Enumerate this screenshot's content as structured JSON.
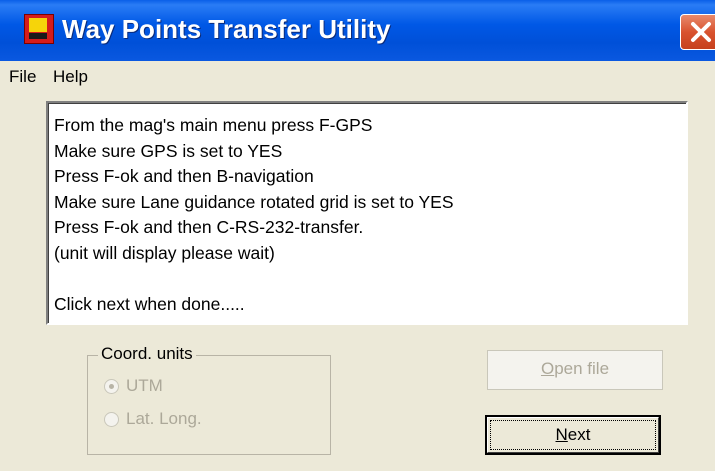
{
  "window": {
    "title": "Way Points Transfer Utility",
    "accent": "#0055e5",
    "close_color": "#d9532f",
    "icons": {
      "app": "app-icon",
      "close": "close-icon"
    }
  },
  "menu": {
    "items": [
      {
        "label": "File"
      },
      {
        "label": "Help"
      }
    ]
  },
  "instructions": {
    "lines": [
      "From the mag's main menu press F-GPS",
      "Make sure GPS is set to YES",
      "Press F-ok and then B-navigation",
      "Make sure Lane guidance rotated grid is set to YES",
      "Press F-ok and then C-RS-232-transfer.",
      "(unit will display please wait)",
      "",
      "Click next when done....."
    ]
  },
  "coord_units": {
    "legend": "Coord. units",
    "options": [
      {
        "label": "UTM",
        "selected": true,
        "enabled": false
      },
      {
        "label": "Lat. Long.",
        "selected": false,
        "enabled": false
      }
    ]
  },
  "buttons": {
    "open_file": {
      "mnemonic": "O",
      "rest": "pen file",
      "enabled": false
    },
    "next": {
      "mnemonic": "N",
      "rest": "ext",
      "enabled": true,
      "default": true
    }
  }
}
